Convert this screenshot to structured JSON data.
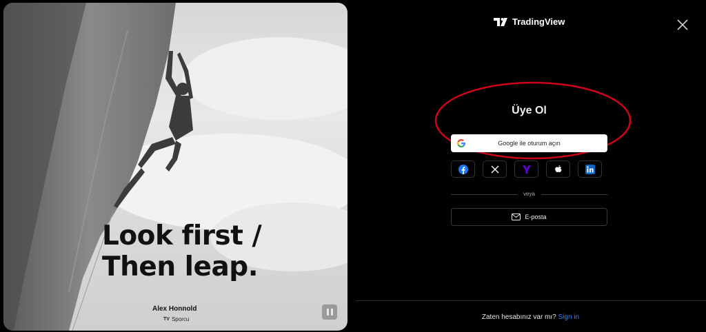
{
  "hero": {
    "headline_line1": "Look first /",
    "headline_line2": "Then leap.",
    "athlete_name": "Alex Honnold",
    "athlete_role": "Sporcu",
    "role_logo": "TV"
  },
  "header": {
    "brand": "TradingView"
  },
  "auth": {
    "title": "Üye Ol",
    "google_label": "Google ile oturum açın",
    "social": [
      "facebook-icon",
      "x-icon",
      "yahoo-icon",
      "apple-icon",
      "linkedin-icon"
    ],
    "divider_text": "veya",
    "email_label": "E-posta"
  },
  "footer": {
    "prompt": "Zaten hesabınız var mı?",
    "signin": "Sign in"
  },
  "colors": {
    "background": "#000000",
    "link": "#2f80ed",
    "annotation": "#d0021b"
  }
}
